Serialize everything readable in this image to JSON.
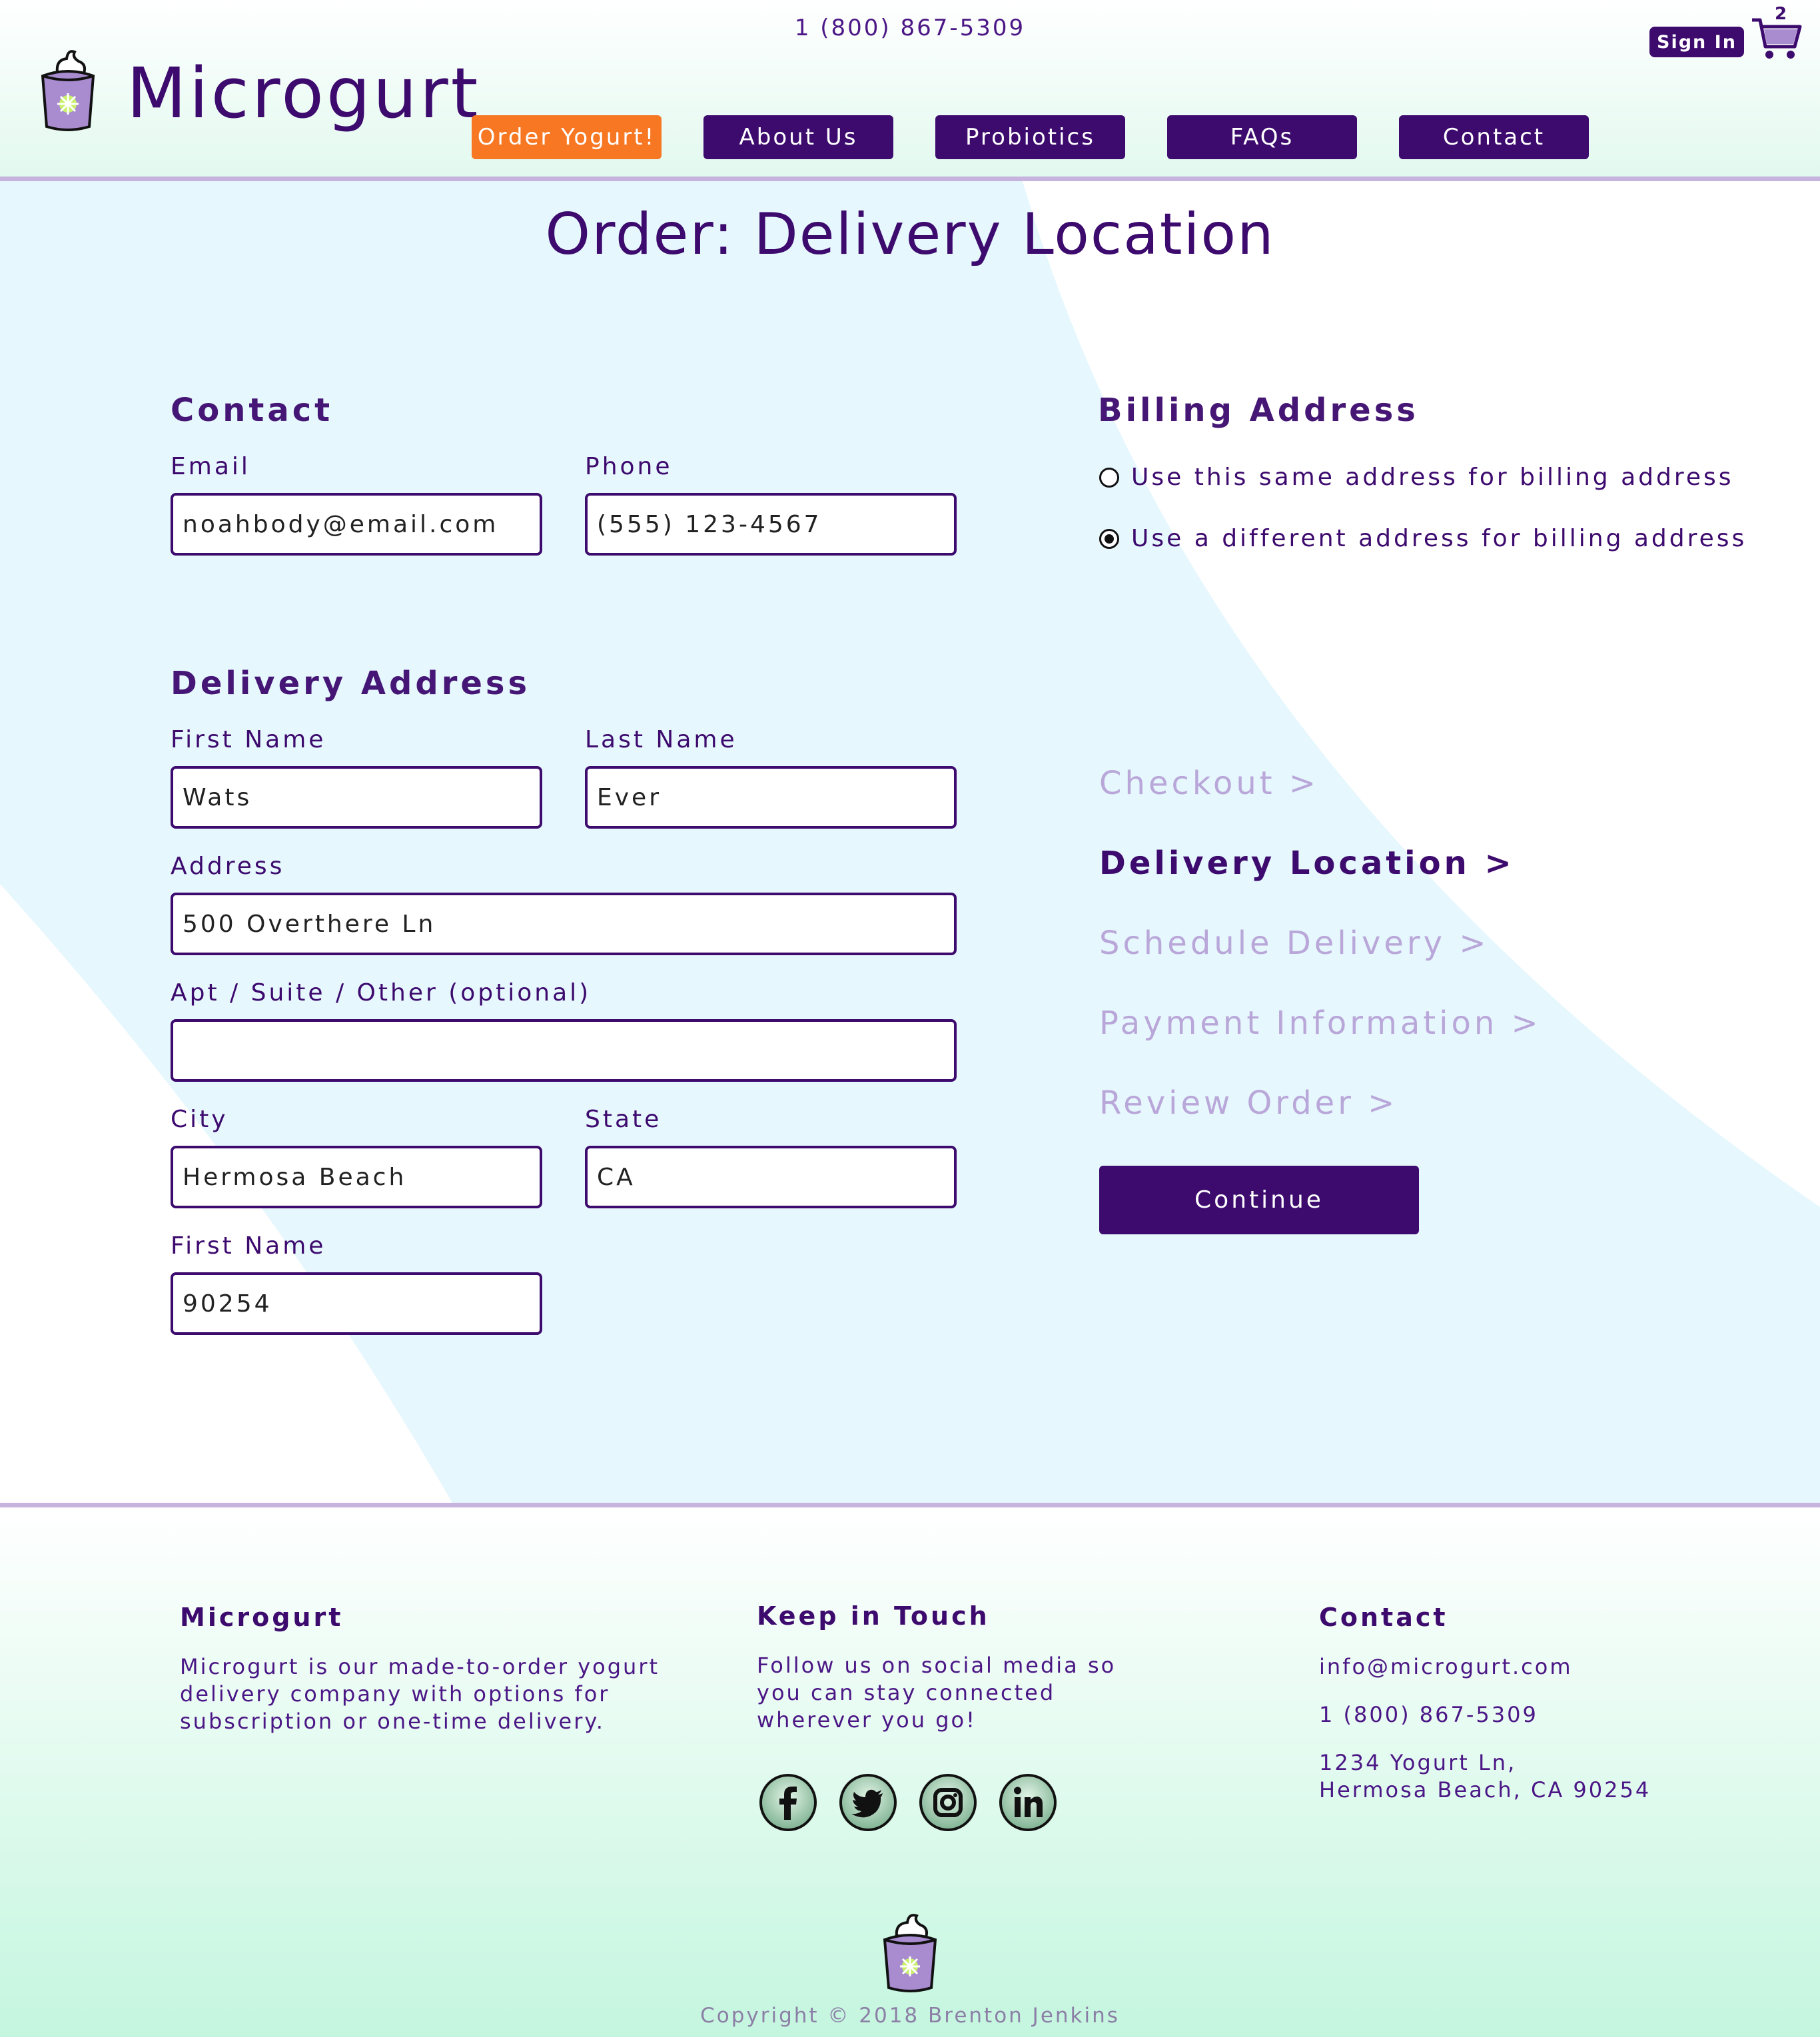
{
  "header": {
    "phone": "1 (800) 867-5309",
    "brand": "Microgurt",
    "nav": [
      {
        "label": "Order Yogurt!"
      },
      {
        "label": "About Us"
      },
      {
        "label": "Probiotics"
      },
      {
        "label": "FAQs"
      },
      {
        "label": "Contact"
      }
    ],
    "sign_in": "Sign In",
    "cart_count": "2"
  },
  "page": {
    "title": "Order: Delivery Location"
  },
  "contact": {
    "heading": "Contact",
    "email_label": "Email",
    "email_value": "noahbody@email.com",
    "phone_label": "Phone",
    "phone_value": "(555) 123-4567"
  },
  "delivery": {
    "heading": "Delivery Address",
    "first_name_label": "First Name",
    "first_name_value": "Wats",
    "last_name_label": "Last Name",
    "last_name_value": "Ever",
    "address_label": "Address",
    "address_value": "500 Overthere Ln",
    "apt_label": "Apt / Suite / Other (optional)",
    "apt_value": "",
    "city_label": "City",
    "city_value": "Hermosa Beach",
    "state_label": "State",
    "state_value": "CA",
    "zip_label": "First Name",
    "zip_value": "90254"
  },
  "billing": {
    "heading": "Billing Address",
    "options": [
      {
        "label": "Use this same address for billing address",
        "checked": false
      },
      {
        "label": "Use a different address for billing address",
        "checked": true
      }
    ]
  },
  "steps": [
    {
      "label": "Checkout >",
      "active": false
    },
    {
      "label": "Delivery Location >",
      "active": true
    },
    {
      "label": "Schedule Delivery >",
      "active": false
    },
    {
      "label": "Payment Information >",
      "active": false
    },
    {
      "label": "Review Order >",
      "active": false
    }
  ],
  "continue_label": "Continue",
  "footer": {
    "col1": {
      "heading": "Microgurt",
      "text_lines": [
        "Microgurt is our made-to-order yogurt",
        "delivery company with options for",
        "subscription or one-time delivery."
      ]
    },
    "col2": {
      "heading": "Keep in Touch",
      "text_lines": [
        "Follow us on social media so",
        "you can stay connected",
        "wherever you go!"
      ],
      "social": [
        "facebook-icon",
        "twitter-icon",
        "instagram-icon",
        "linkedin-icon"
      ]
    },
    "col3": {
      "heading": "Contact",
      "email": "info@microgurt.com",
      "phone": "1 (800) 867-5309",
      "address_line1": "1234 Yogurt Ln,",
      "address_line2": "Hermosa Beach, CA 90254"
    },
    "copyright": "Copyright © 2018 Brenton Jenkins"
  },
  "colors": {
    "primary": "#3d0a6e",
    "accent": "#f77722",
    "muted_step": "#b9a7d9",
    "bg_blue": "#e6f7fd",
    "footer_green": "#c4f6df"
  }
}
